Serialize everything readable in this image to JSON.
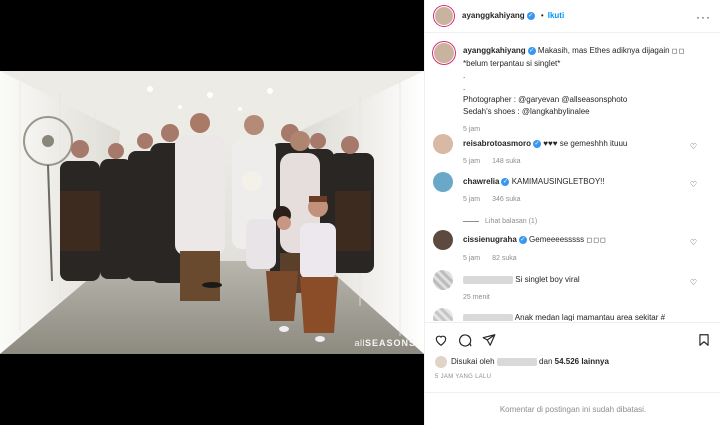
{
  "photo": {
    "watermark_prefix": "all",
    "watermark_main": "SEASONS"
  },
  "header": {
    "username": "ayanggkahiyang",
    "separator": "•",
    "follow_label": "Ikuti"
  },
  "caption": {
    "username": "ayanggkahiyang",
    "text": "Makasih, mas Ethes adiknya dijagain ",
    "line2": "*belum terpantau si singlet*",
    "dot1": ".",
    "dot2": ".",
    "photographer": "Photographer : @garyevan @allseasonsphoto",
    "shoes": "Sedah's shoes : @langkahbylinalee",
    "time": "5 jam"
  },
  "comments": [
    {
      "username": "reisabrotoasmoro",
      "text": "♥♥♥ se gemeshhh ituuu",
      "time": "5 jam",
      "likes": "148 suka"
    },
    {
      "username": "chawrelia",
      "text": "KAMIMAUSINGLETBOY!!",
      "time": "5 jam",
      "likes": "346 suka",
      "replies": "Lihat balasan (1)"
    },
    {
      "username": "cissienugraha",
      "text": "Gemeeeesssss ",
      "time": "5 jam",
      "likes": "82 suka"
    },
    {
      "username": "",
      "text": "Si singlet boy viral",
      "time": "25 menit"
    },
    {
      "username": "",
      "text": "Anak medan lagi mamantau area sekitar #"
    }
  ],
  "likes": {
    "prefix": "Disukai oleh",
    "middle": "dan",
    "count": "54.526 lainnya"
  },
  "date": "5 JAM YANG LALU",
  "footer": "Komentar di postingan ini sudah dibatasi.",
  "colors": {
    "link": "#00376b",
    "accent": "#0095f6",
    "verified": "#3897f0",
    "muted": "#8e8e8e"
  }
}
